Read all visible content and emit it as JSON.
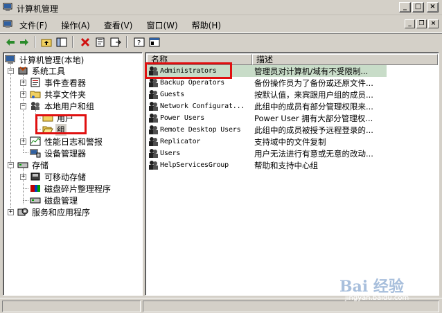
{
  "window": {
    "title": "计算机管理"
  },
  "menu": {
    "items": [
      "文件(F)",
      "操作(A)",
      "查看(V)",
      "窗口(W)",
      "帮助(H)"
    ]
  },
  "tree": {
    "items": [
      {
        "label": "计算机管理(本地)",
        "icon": "computer-mgmt-icon"
      },
      {
        "label": "系统工具",
        "icon": "tools-icon"
      },
      {
        "label": "事件查看器",
        "icon": "event-viewer-icon"
      },
      {
        "label": "共享文件夹",
        "icon": "shared-folder-icon"
      },
      {
        "label": "本地用户和组",
        "icon": "users-groups-icon"
      },
      {
        "label": "用户",
        "icon": "folder-icon"
      },
      {
        "label": "组",
        "icon": "folder-open-icon"
      },
      {
        "label": "性能日志和警报",
        "icon": "perf-log-icon"
      },
      {
        "label": "设备管理器",
        "icon": "device-manager-icon"
      },
      {
        "label": "存储",
        "icon": "storage-icon"
      },
      {
        "label": "可移动存储",
        "icon": "removable-storage-icon"
      },
      {
        "label": "磁盘碎片整理程序",
        "icon": "defrag-icon"
      },
      {
        "label": "磁盘管理",
        "icon": "disk-mgmt-icon"
      },
      {
        "label": "服务和应用程序",
        "icon": "services-icon"
      }
    ]
  },
  "list": {
    "columns": [
      "名称",
      "描述"
    ],
    "rows": [
      {
        "name": "Administrators",
        "desc": "管理员对计算机/域有不受限制..."
      },
      {
        "name": "Backup Operators",
        "desc": "备份操作员为了备份或还原文件..."
      },
      {
        "name": "Guests",
        "desc": "按默认值，来宾跟用户组的成员..."
      },
      {
        "name": "Network Configurat...",
        "desc": "此组中的成员有部分管理权限来..."
      },
      {
        "name": "Power Users",
        "desc": "Power User 拥有大部分管理权..."
      },
      {
        "name": "Remote Desktop Users",
        "desc": "此组中的成员被授予远程登录的..."
      },
      {
        "name": "Replicator",
        "desc": "支持域中的文件复制"
      },
      {
        "name": "Users",
        "desc": "用户无法进行有意或无意的改动..."
      },
      {
        "name": "HelpServicesGroup",
        "desc": "帮助和支持中心组"
      }
    ]
  },
  "watermark": {
    "logo": "Bai 经验",
    "url": "jingyan.baidu.com"
  },
  "colors": {
    "highlight": "#e01010",
    "selection": "#c8dcc8",
    "chrome": "#d4d0c8"
  }
}
